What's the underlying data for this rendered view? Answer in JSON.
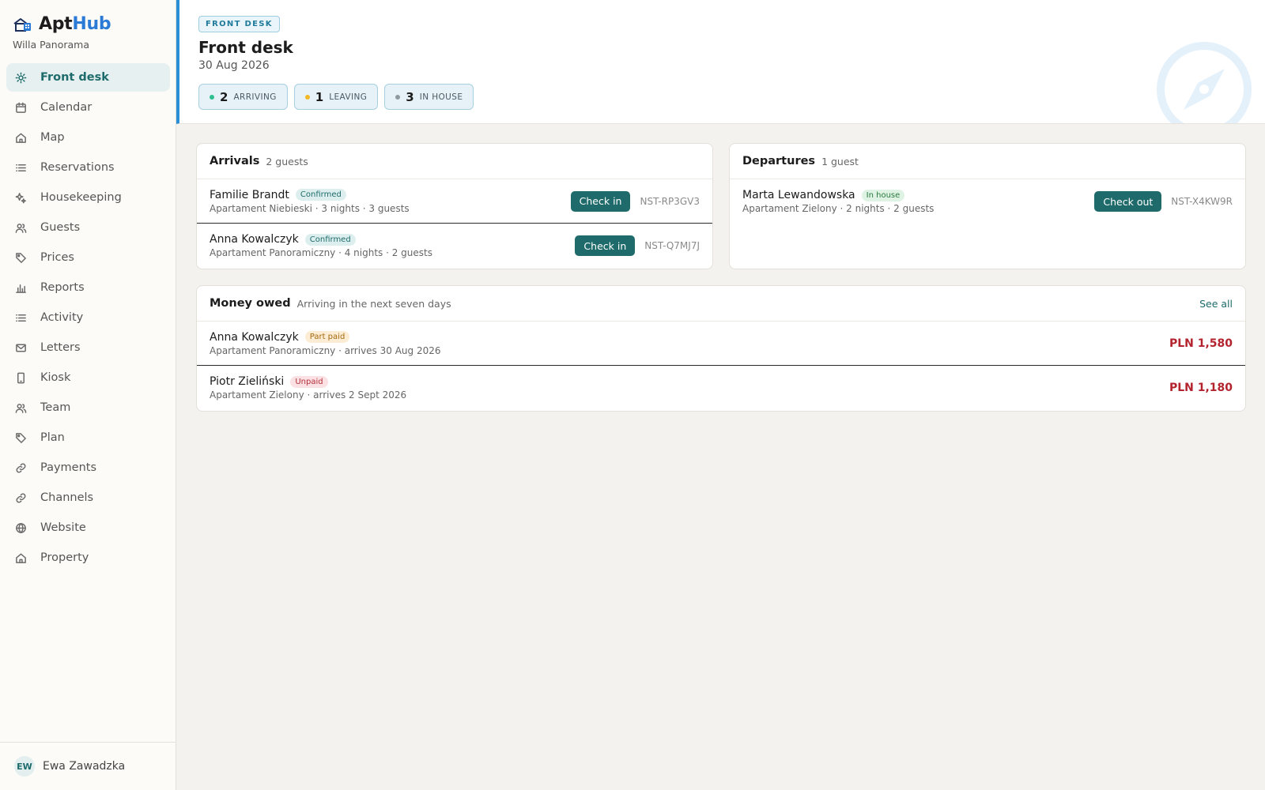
{
  "brand": {
    "name_part1": "Apt",
    "name_part2": "Hub",
    "property": "Willa Panorama"
  },
  "nav": [
    {
      "label": "Front desk",
      "icon": "sun-icon",
      "active": true
    },
    {
      "label": "Calendar",
      "icon": "calendar-icon"
    },
    {
      "label": "Map",
      "icon": "home-icon"
    },
    {
      "label": "Reservations",
      "icon": "list-icon"
    },
    {
      "label": "Housekeeping",
      "icon": "sparkle-icon"
    },
    {
      "label": "Guests",
      "icon": "users-icon"
    },
    {
      "label": "Prices",
      "icon": "tag-icon"
    },
    {
      "label": "Reports",
      "icon": "bar-chart-icon"
    },
    {
      "label": "Activity",
      "icon": "list-icon"
    },
    {
      "label": "Letters",
      "icon": "mail-icon"
    },
    {
      "label": "Kiosk",
      "icon": "tablet-icon"
    },
    {
      "label": "Team",
      "icon": "users-icon"
    },
    {
      "label": "Plan",
      "icon": "tag-icon"
    },
    {
      "label": "Payments",
      "icon": "link-icon"
    },
    {
      "label": "Channels",
      "icon": "link-icon"
    },
    {
      "label": "Website",
      "icon": "globe-icon"
    },
    {
      "label": "Property",
      "icon": "home-icon"
    }
  ],
  "user": {
    "initials": "EW",
    "name": "Ewa Zawadzka"
  },
  "header": {
    "eyebrow": "FRONT DESK",
    "title": "Front desk",
    "date": "30 Aug 2026",
    "stats": [
      {
        "count": "2",
        "label": "ARRIVING",
        "color": "#2fbf8f"
      },
      {
        "count": "1",
        "label": "LEAVING",
        "color": "#f2b824"
      },
      {
        "count": "3",
        "label": "IN HOUSE",
        "color": "#8e9aa0"
      }
    ]
  },
  "arrivals": {
    "title": "Arrivals",
    "count": "2 guests",
    "rows": [
      {
        "guest": "Familie Brandt",
        "status": "Confirmed",
        "details": "Apartament Niebieski · 3 nights · 3 guests",
        "action": "Check in",
        "ref": "NST-RP3GV3"
      },
      {
        "guest": "Anna Kowalczyk",
        "status": "Confirmed",
        "details": "Apartament Panoramiczny · 4 nights · 2 guests",
        "action": "Check in",
        "ref": "NST-Q7MJ7J"
      }
    ]
  },
  "departures": {
    "title": "Departures",
    "count": "1 guest",
    "rows": [
      {
        "guest": "Marta Lewandowska",
        "status": "In house",
        "details": "Apartament Zielony · 2 nights · 2 guests",
        "action": "Check out",
        "ref": "NST-X4KW9R"
      }
    ]
  },
  "money": {
    "title": "Money owed",
    "subtitle": "Arriving in the next seven days",
    "see_all": "See all",
    "rows": [
      {
        "guest": "Anna Kowalczyk",
        "status": "Part paid",
        "details": "Apartament Panoramiczny · arrives 30 Aug 2026",
        "amount": "PLN 1,580"
      },
      {
        "guest": "Piotr Zieliński",
        "status": "Unpaid",
        "details": "Apartament Zielony · arrives 2 Sept 2026",
        "amount": "PLN 1,180"
      }
    ]
  },
  "colors": {
    "accent": "#1f6b6b",
    "brand_blue": "#2b7bd6",
    "owed": "#b3232e"
  }
}
